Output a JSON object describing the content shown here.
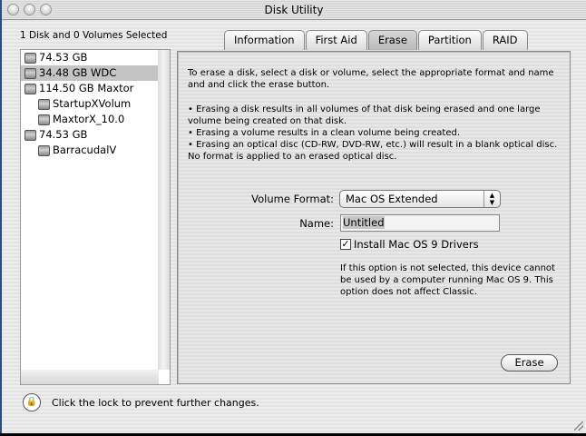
{
  "window": {
    "title": "Disk Utility"
  },
  "sidebar": {
    "selection_label": "1 Disk and 0 Volumes Selected",
    "items": [
      {
        "label": "74.53 GB",
        "level": 0,
        "selected": false
      },
      {
        "label": "34.48 GB WDC",
        "level": 0,
        "selected": true
      },
      {
        "label": "114.50 GB Maxtor",
        "level": 0,
        "selected": false
      },
      {
        "label": "StartupXVolum",
        "level": 1,
        "selected": false
      },
      {
        "label": "MaxtorX_10.0",
        "level": 1,
        "selected": false
      },
      {
        "label": "74.53 GB",
        "level": 0,
        "selected": false
      },
      {
        "label": "BarracudalV",
        "level": 1,
        "selected": false
      }
    ]
  },
  "tabs": [
    {
      "label": "Information"
    },
    {
      "label": "First Aid"
    },
    {
      "label": "Erase",
      "active": true
    },
    {
      "label": "Partition"
    },
    {
      "label": "RAID"
    }
  ],
  "erase": {
    "intro": "To erase a disk, select a disk or volume, select the appropriate format and name and and click the erase button.",
    "bullets": [
      "• Erasing a disk results in all volumes of that disk being erased and one large volume being created on that disk.",
      "• Erasing a volume results in a clean volume being created.",
      "• Erasing an optical disc (CD-RW, DVD-RW, etc.) will result in a blank optical disc. No format is applied to an erased optical disc."
    ],
    "format_label": "Volume Format:",
    "format_value": "Mac OS Extended",
    "name_label": "Name:",
    "name_value": "Untitled",
    "checkbox_label": "Install Mac OS 9 Drivers",
    "checkbox_checked": true,
    "note": "If this option is not selected, this device cannot be used by a computer running Mac OS 9.  This option does not affect Classic.",
    "erase_button": "Erase"
  },
  "footer": {
    "lock_text": "Click the lock to prevent further changes."
  }
}
